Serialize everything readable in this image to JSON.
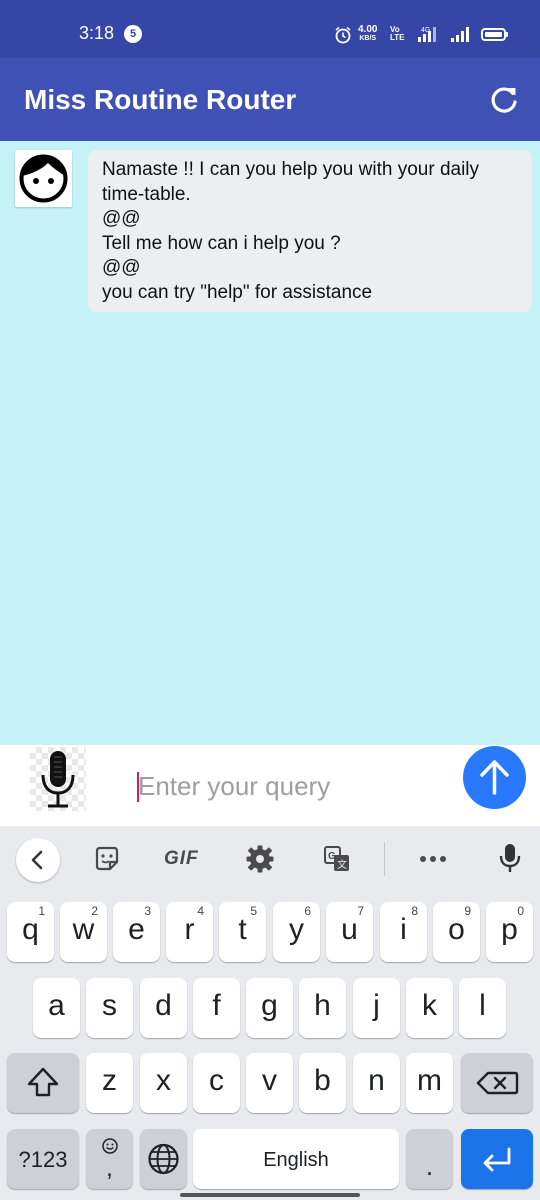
{
  "status_bar": {
    "time": "3:18",
    "notification_count": "5",
    "net_speed": "4.00",
    "net_speed_unit": "KB/S",
    "volte_top": "Vo",
    "volte_bottom": "LTE",
    "network_type": "4G"
  },
  "app_bar": {
    "title": "Miss Routine Router",
    "refresh_icon": "refresh-icon"
  },
  "chat": {
    "messages": [
      {
        "sender": "bot",
        "avatar_icon": "face-icon",
        "lines": [
          "Namaste !! I can you help you with your daily",
          "time-table.",
          "@@",
          "Tell me how can i help you ?",
          "@@",
          "you can try \"help\" for assistance"
        ]
      }
    ]
  },
  "input": {
    "placeholder": "Enter your query",
    "value": "",
    "mic_icon": "microphone-icon",
    "send_icon": "arrow-up-icon"
  },
  "keyboard": {
    "toolbar": [
      "chevron-left-icon",
      "sticker-icon",
      "GIF",
      "settings-icon",
      "translate-icon",
      "more-icon",
      "mic-icon"
    ],
    "row1": [
      {
        "k": "q",
        "h": "1"
      },
      {
        "k": "w",
        "h": "2"
      },
      {
        "k": "e",
        "h": "3"
      },
      {
        "k": "r",
        "h": "4"
      },
      {
        "k": "t",
        "h": "5"
      },
      {
        "k": "y",
        "h": "6"
      },
      {
        "k": "u",
        "h": "7"
      },
      {
        "k": "i",
        "h": "8"
      },
      {
        "k": "o",
        "h": "9"
      },
      {
        "k": "p",
        "h": "0"
      }
    ],
    "row2": [
      "a",
      "s",
      "d",
      "f",
      "g",
      "h",
      "j",
      "k",
      "l"
    ],
    "row3": [
      "z",
      "x",
      "c",
      "v",
      "b",
      "n",
      "m"
    ],
    "symbols_label": "?123",
    "comma_label": ",",
    "space_label": "English",
    "period_label": ".",
    "colors": {
      "accent": "#1a73e8",
      "app_bar": "#3f51b5",
      "chat_bg": "#c4f2f6"
    }
  }
}
